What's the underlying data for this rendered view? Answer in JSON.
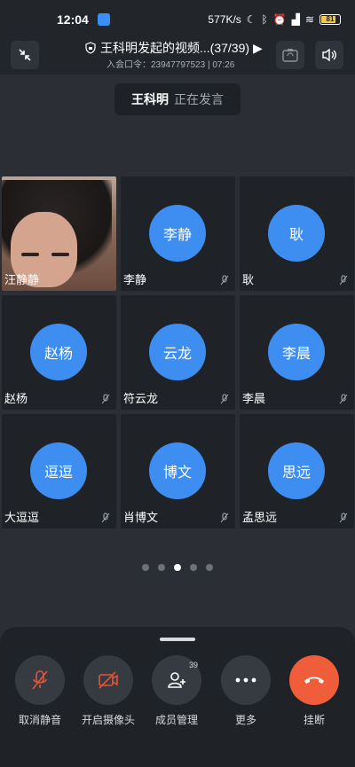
{
  "status_bar": {
    "time": "12:04",
    "network_speed": "577K/s",
    "battery": "81"
  },
  "meeting": {
    "title": "王科明发起的视频...(37/39)",
    "subtitle": "入会口令：23947797523 | 07:26",
    "speaker_name": "王科明",
    "speaker_status": "正在发言"
  },
  "participants": [
    {
      "name": "汪静静",
      "avatar": "",
      "muted": false,
      "video": true
    },
    {
      "name": "李静",
      "avatar": "李静",
      "muted": true,
      "video": false
    },
    {
      "name": "耿",
      "avatar": "耿",
      "muted": true,
      "video": false
    },
    {
      "name": "赵杨",
      "avatar": "赵杨",
      "muted": true,
      "video": false
    },
    {
      "name": "符云龙",
      "avatar": "云龙",
      "muted": true,
      "video": false
    },
    {
      "name": "李晨",
      "avatar": "李晨",
      "muted": true,
      "video": false
    },
    {
      "name": "大逗逗",
      "avatar": "逗逗",
      "muted": true,
      "video": false
    },
    {
      "name": "肖博文",
      "avatar": "博文",
      "muted": true,
      "video": false
    },
    {
      "name": "孟思远",
      "avatar": "思远",
      "muted": true,
      "video": false
    }
  ],
  "pager": {
    "count": 5,
    "active": 3
  },
  "controls": {
    "unmute": "取消静音",
    "camera": "开启摄像头",
    "members": "成员管理",
    "members_count": "39",
    "more": "更多",
    "hangup": "挂断"
  },
  "colors": {
    "avatar_blue": "#3d8ef0",
    "hangup_orange": "#f05d3a",
    "mute_red": "#e0553a"
  }
}
